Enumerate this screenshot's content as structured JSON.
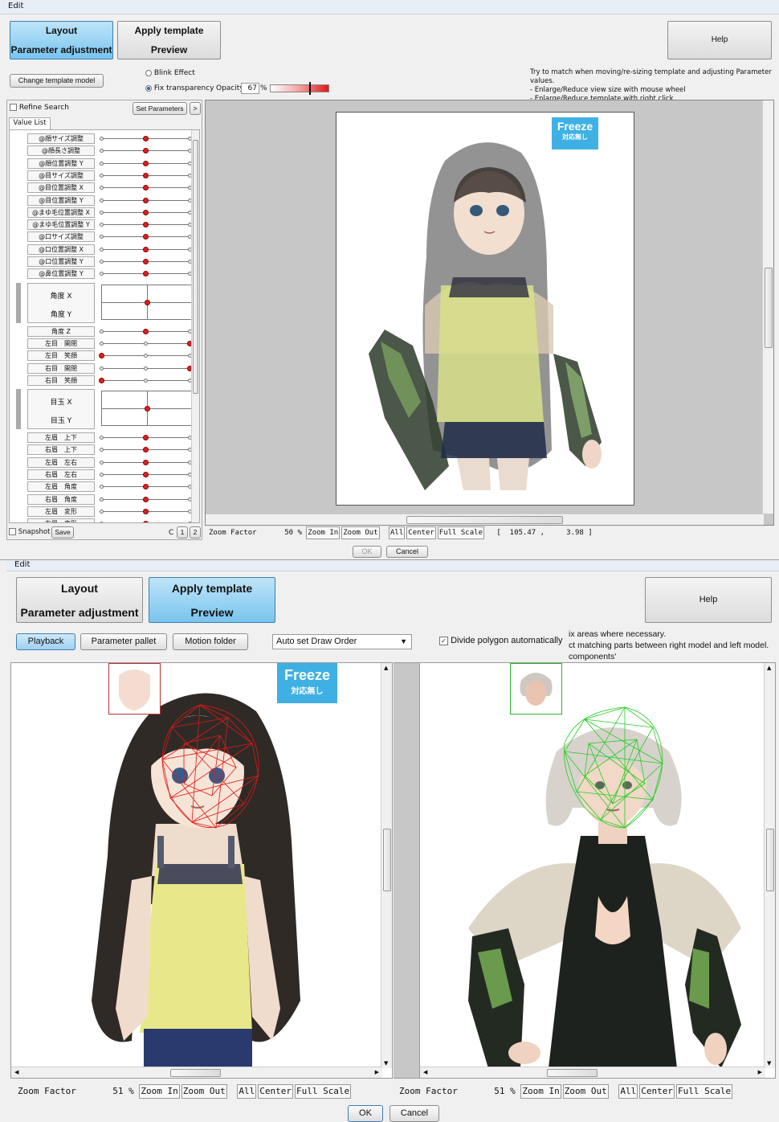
{
  "top": {
    "window_title": "Edit",
    "tabs": [
      {
        "label": "Layout"
      },
      {
        "label": "Apply template"
      },
      {
        "label": "Parameter adjustment"
      },
      {
        "label": "Preview"
      }
    ],
    "help_label": "Help",
    "change_template_label": "Change template model",
    "blink_label": "Blink Effect",
    "fix_transparency_label": "Fix transparency",
    "opacity_label": "Opacity",
    "opacity_value": "67",
    "opacity_unit": "%",
    "opacity_level": 0.67,
    "hint_lines": [
      "Try to match when moving/re-sizing template and adjusting Parameter values.",
      "- Enlarge/Reduce view size with mouse wheel",
      "- Enlarge/Reduce template with right click."
    ],
    "refine_search_label": "Refine Search",
    "set_parameters_label": "Set Parameters",
    "arrow_label": ">",
    "value_list_tab": "Value List",
    "params": [
      {
        "label": "@顔サイズ調整",
        "pos": 0.5
      },
      {
        "label": "@顔長さ調整",
        "pos": 0.5
      },
      {
        "label": "@顔位置調整 Y",
        "pos": 0.5
      },
      {
        "label": "@目サイズ調整",
        "pos": 0.5
      },
      {
        "label": "@目位置調整 X",
        "pos": 0.5
      },
      {
        "label": "@目位置調整 Y",
        "pos": 0.5
      },
      {
        "label": "@まゆ毛位置調整 X",
        "pos": 0.5
      },
      {
        "label": "@まゆ毛位置調整 Y",
        "pos": 0.5
      },
      {
        "label": "@口サイズ調整",
        "pos": 0.5
      },
      {
        "label": "@口位置調整 X",
        "pos": 0.5
      },
      {
        "label": "@口位置調整 Y",
        "pos": 0.5
      },
      {
        "label": "@鼻位置調整 Y",
        "pos": 0.5
      }
    ],
    "angle_xy": {
      "x": "角度 X",
      "y": "角度 Y"
    },
    "params2": [
      {
        "label": "角度 Z",
        "pos": 0.5
      },
      {
        "label": "左目　開閉",
        "pos": 1
      },
      {
        "label": "左目　笑顔",
        "pos": 0
      },
      {
        "label": "右目　開閉",
        "pos": 1
      },
      {
        "label": "右目　笑顔",
        "pos": 0
      }
    ],
    "eye_xy": {
      "x": "目玉 X",
      "y": "目玉 Y"
    },
    "params3": [
      {
        "label": "左眉　上下",
        "pos": 0.5
      },
      {
        "label": "右眉　上下",
        "pos": 0.5
      },
      {
        "label": "左眉　左右",
        "pos": 0.5
      },
      {
        "label": "右眉　左右",
        "pos": 0.5
      },
      {
        "label": "左眉　角度",
        "pos": 0.5
      },
      {
        "label": "右眉　角度",
        "pos": 0.5
      },
      {
        "label": "左眉　変形",
        "pos": 0.5
      },
      {
        "label": "右眉　変形",
        "pos": 0.5
      }
    ],
    "snapshot_label": "Snapshot",
    "save_label": "Save",
    "c_label": "C",
    "slot1": "1",
    "slot2": "2",
    "zoom_label": "Zoom Factor",
    "zoom_value": "50",
    "zoom_unit": "%",
    "zoom_in": "Zoom In",
    "zoom_out": "Zoom Out",
    "all": "All",
    "center": "Center",
    "full_scale": "Full Scale",
    "coords": "[  105.47 ,     3.98 ]",
    "ok": "OK",
    "cancel": "Cancel",
    "freeze_title": "Freeze",
    "freeze_sub": "対応無し"
  },
  "bottom": {
    "window_title": "Edit",
    "tabs": [
      {
        "label": "Layout"
      },
      {
        "label": "Apply template"
      },
      {
        "label": "Parameter adjustment"
      },
      {
        "label": "Preview"
      }
    ],
    "help_label": "Help",
    "playback": "Playback",
    "parameter_pallet": "Parameter pallet",
    "motion_folder": "Motion folder",
    "draw_order": "Auto set Draw Order",
    "divide_polygon": "Divide polygon automatically",
    "hint_lines": [
      "ix areas where necessary.",
      "ct matching parts between right model and left model.",
      "components'"
    ],
    "zoom_label": "Zoom Factor",
    "zoom_value_left": "51",
    "zoom_value_right": "51",
    "zoom_unit": "%",
    "zoom_in": "Zoom In",
    "zoom_out": "Zoom Out",
    "all": "All",
    "center": "Center",
    "full_scale": "Full Scale",
    "ok": "OK",
    "cancel": "Cancel",
    "freeze_title": "Freeze",
    "freeze_sub": "対応無し"
  },
  "colors": {
    "mesh_left": "#e01818",
    "mesh_right": "#22cc22",
    "freeze": "#3fb0e3",
    "tab_selected": "#79c4ee"
  }
}
